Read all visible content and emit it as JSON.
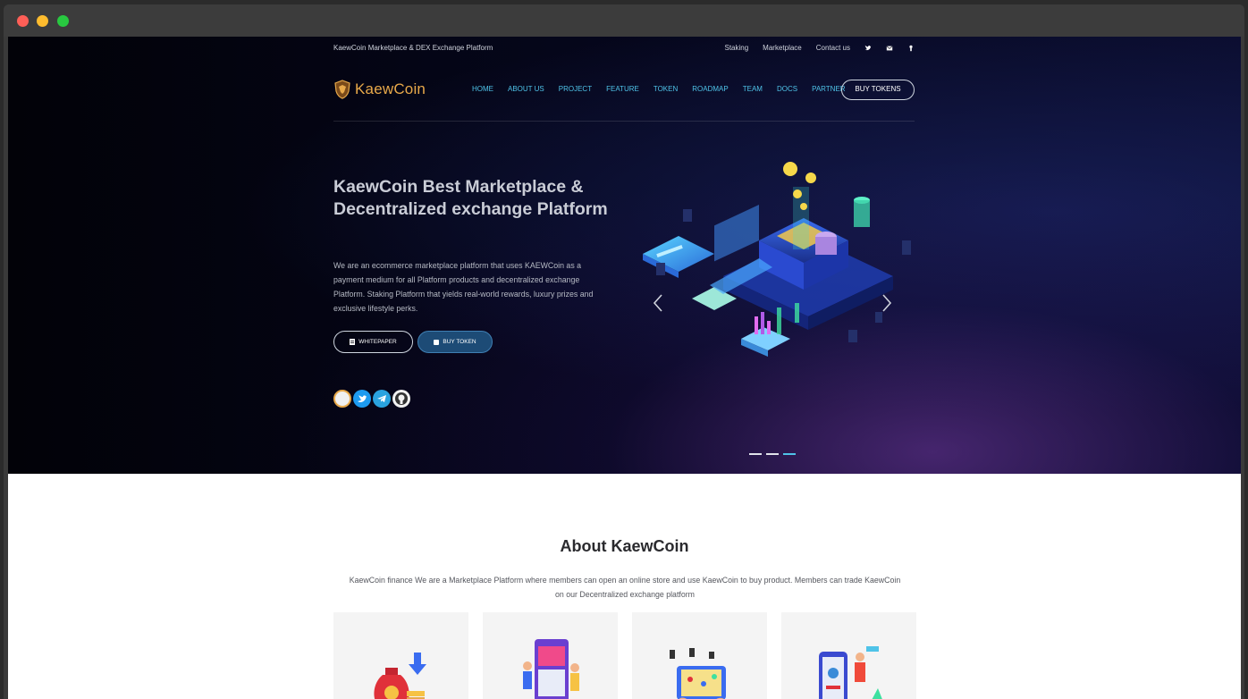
{
  "topbar": {
    "tagline": "KaewCoin Marketplace & DEX Exchange Platform",
    "links": [
      "Staking",
      "Marketplace",
      "Contact us"
    ]
  },
  "brand": {
    "name": "KaewCoin"
  },
  "nav": {
    "items": [
      "HOME",
      "ABOUT US",
      "PROJECT",
      "FEATURE",
      "TOKEN",
      "ROADMAP",
      "TEAM",
      "DOCS",
      "PARTNER"
    ],
    "cta": "BUY TOKENS"
  },
  "hero": {
    "title": "KaewCoin Best Marketplace & Decentralized exchange Platform",
    "description": "We are an ecommerce marketplace platform that uses KAEWCoin as a payment medium for all Platform products and decentralized exchange Platform.  Staking Platform that yields real-world rewards, luxury prizes and exclusive lifestyle perks.",
    "btn_whitepaper": "WHITEPAPER",
    "btn_buy": "BUY TOKEN"
  },
  "about": {
    "title": "About KaewCoin",
    "description": "KaewCoin finance We are a Marketplace Platform where members can open an online store and use KaewCoin to buy product. Members can trade KaewCoin on our Decentralized exchange platform"
  },
  "colors": {
    "accent": "#4fc3e8",
    "brand": "#e8a94a",
    "buy_button": "#1d4b76"
  }
}
